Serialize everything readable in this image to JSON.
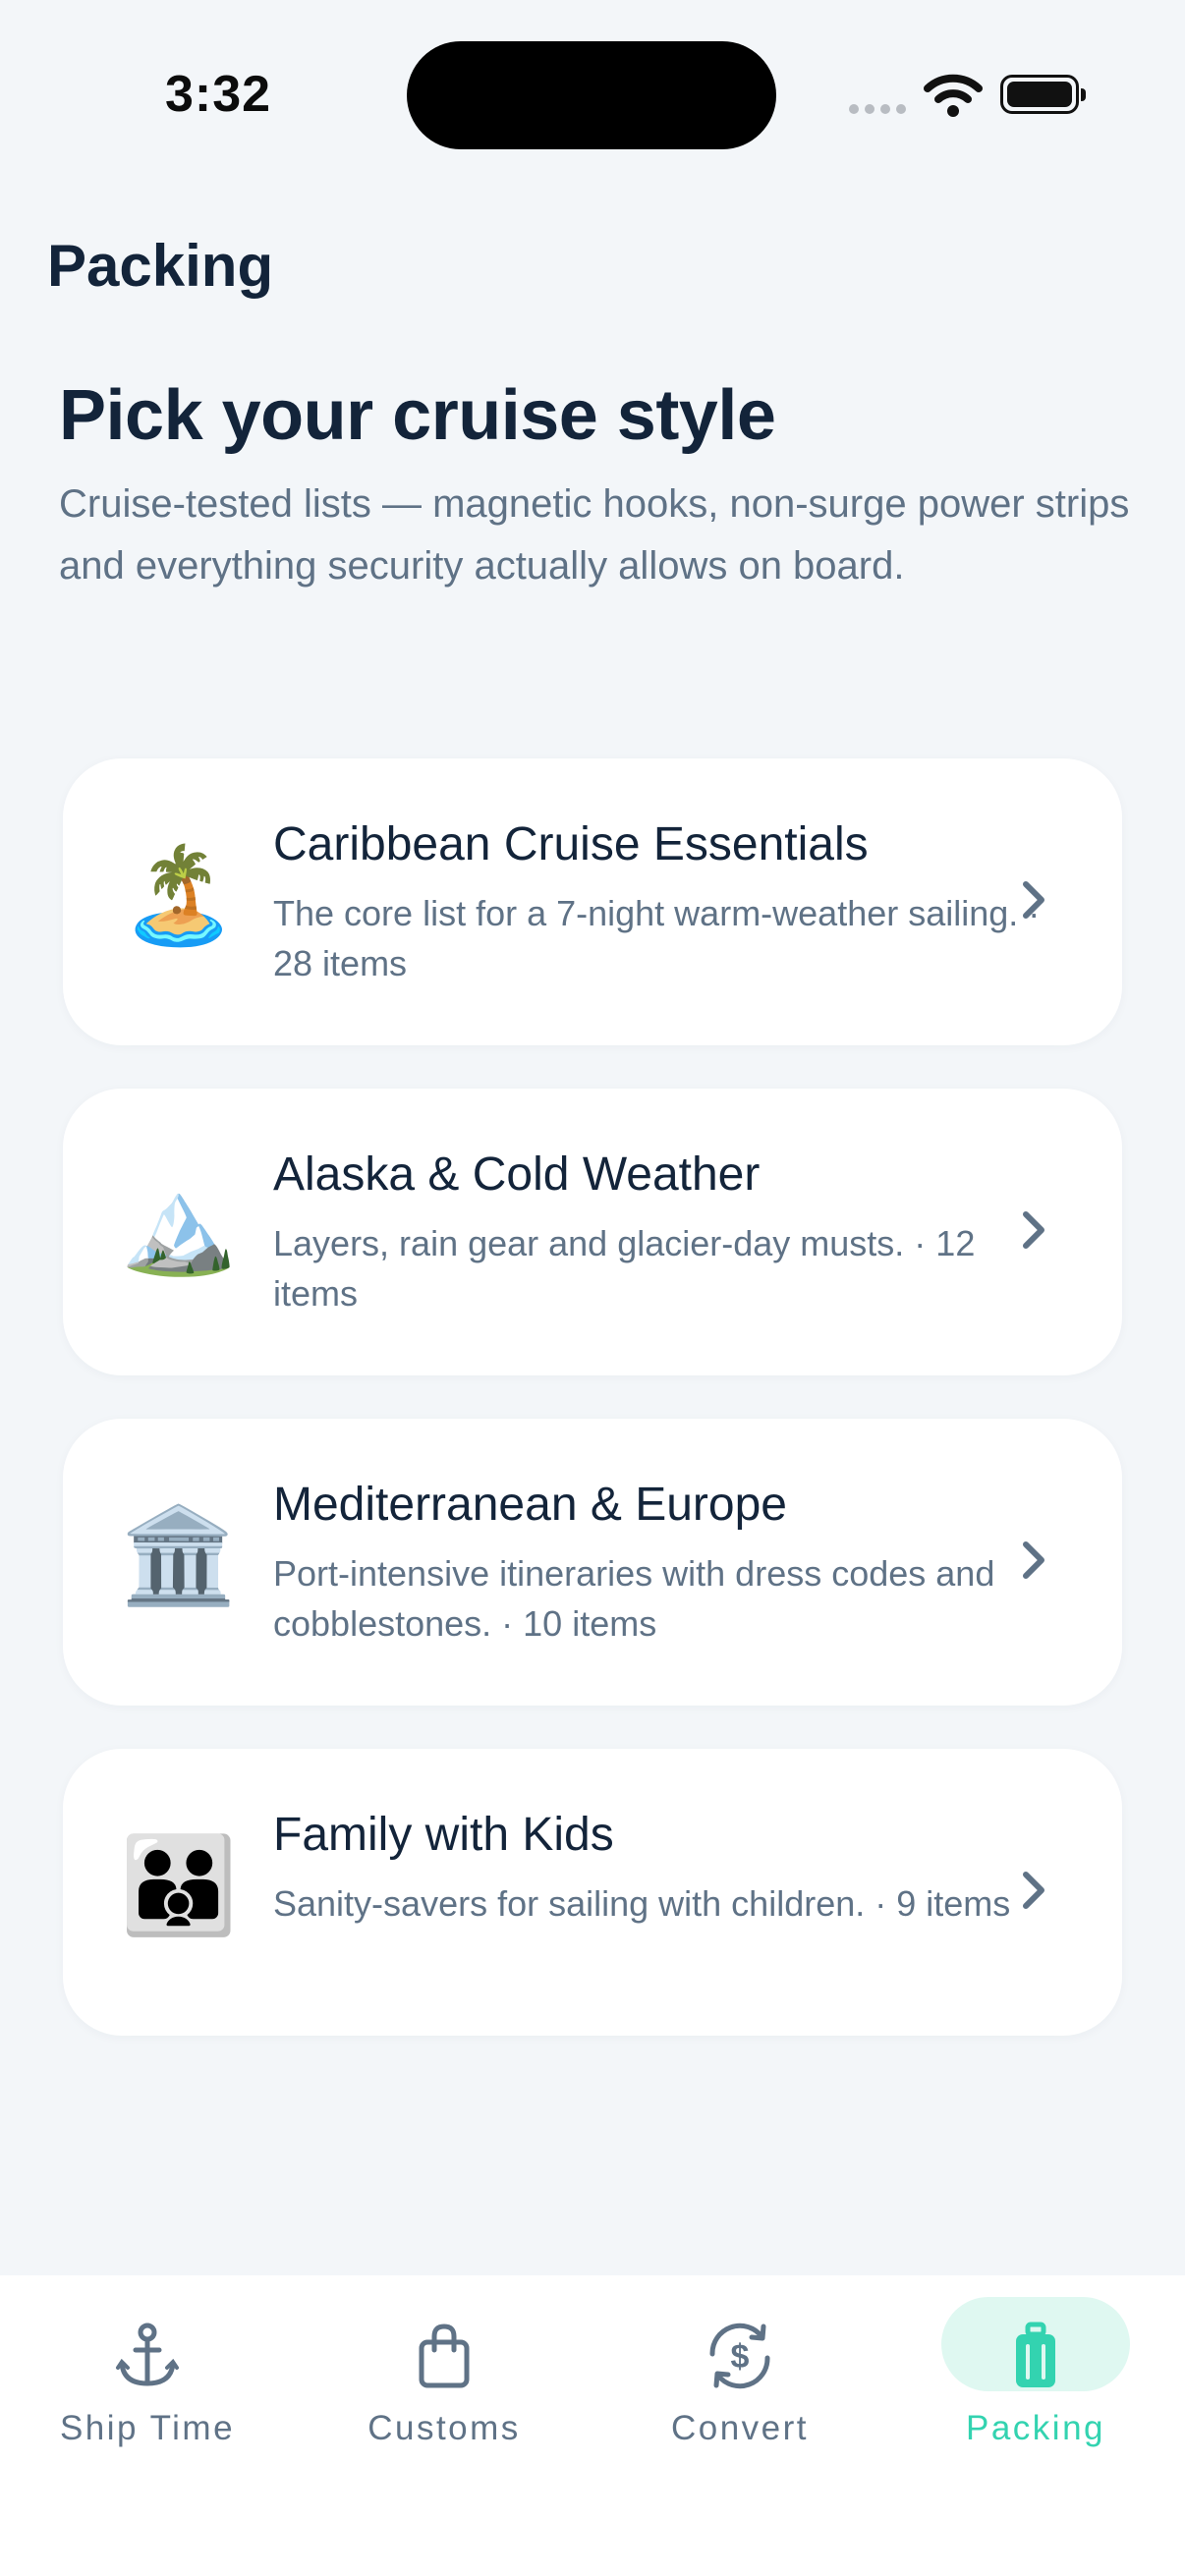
{
  "status_bar": {
    "time": "3:32"
  },
  "header": {
    "title": "Packing"
  },
  "hero": {
    "title": "Pick your cruise style",
    "subtitle": "Cruise-tested lists — magnetic hooks, non-surge power strips and everything security actually allows on board."
  },
  "cards": [
    {
      "emoji": "🏝️",
      "icon": "desert-island-icon",
      "title": "Caribbean Cruise Essentials",
      "description": "The core list for a 7-night warm-weather sailing. · 28 items"
    },
    {
      "emoji": "🏔️",
      "icon": "mountain-icon",
      "title": "Alaska & Cold Weather",
      "description": "Layers, rain gear and glacier-day musts. · 12 items"
    },
    {
      "emoji": "🏛️",
      "icon": "classical-building-icon",
      "title": "Mediterranean & Europe",
      "description": "Port-intensive itineraries with dress codes and cobblestones. · 10 items"
    },
    {
      "emoji": "👪",
      "icon": "family-icon",
      "title": "Family with Kids",
      "description": "Sanity-savers for sailing with children. · 9 items"
    }
  ],
  "tabs": [
    {
      "label": "Ship Time",
      "icon": "anchor-icon",
      "active": false
    },
    {
      "label": "Customs",
      "icon": "shopping-bag-icon",
      "active": false
    },
    {
      "label": "Convert",
      "icon": "currency-exchange-icon",
      "active": false
    },
    {
      "label": "Packing",
      "icon": "suitcase-icon",
      "active": true
    }
  ],
  "colors": {
    "accent": "#33d3b0",
    "accent_bg": "#dff8f1",
    "text_primary": "#13243a",
    "text_secondary": "#5f7286",
    "background": "#f3f6f9"
  }
}
